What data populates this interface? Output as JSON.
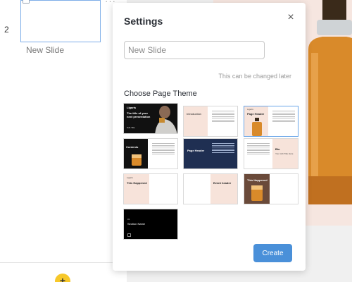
{
  "sidebar": {
    "slide_number": "2",
    "slide_label": "New Slide",
    "ellipsis": "···",
    "add_button": "+"
  },
  "modal": {
    "title": "Settings",
    "close": "×",
    "name_input": {
      "value": "",
      "placeholder": "New Slide"
    },
    "hint": "This can be changed later",
    "section_label": "Choose Page Theme",
    "create_label": "Create",
    "themes": [
      {
        "kind": "title-cover",
        "brand": "Ligaris",
        "heading": "The title of your next presentation",
        "subtitle": "Sub Title"
      },
      {
        "kind": "introduction",
        "heading": "Introduction"
      },
      {
        "kind": "page-header-bottle",
        "brand": "Ligaris",
        "heading": "Page Header",
        "selected": true
      },
      {
        "kind": "contents",
        "heading": "Contents"
      },
      {
        "kind": "page-header-dark",
        "heading": "Page Header"
      },
      {
        "kind": "bio",
        "heading": "Bio",
        "subtitle": "Your Job Title Here"
      },
      {
        "kind": "this-happened",
        "brand": "Ligaris",
        "heading": "This Happened"
      },
      {
        "kind": "event-header",
        "heading": "Event header"
      },
      {
        "kind": "photo-happened",
        "heading": "This Happened"
      },
      {
        "kind": "section-name",
        "heading": "Section Name",
        "subtitle": "01"
      }
    ]
  },
  "colors": {
    "accent": "#4a90d9",
    "dark": "#111111",
    "navy": "#1f2f52",
    "peach": "#f7e3da",
    "amber": "#d98a2a",
    "fab": "#f7c82a"
  }
}
